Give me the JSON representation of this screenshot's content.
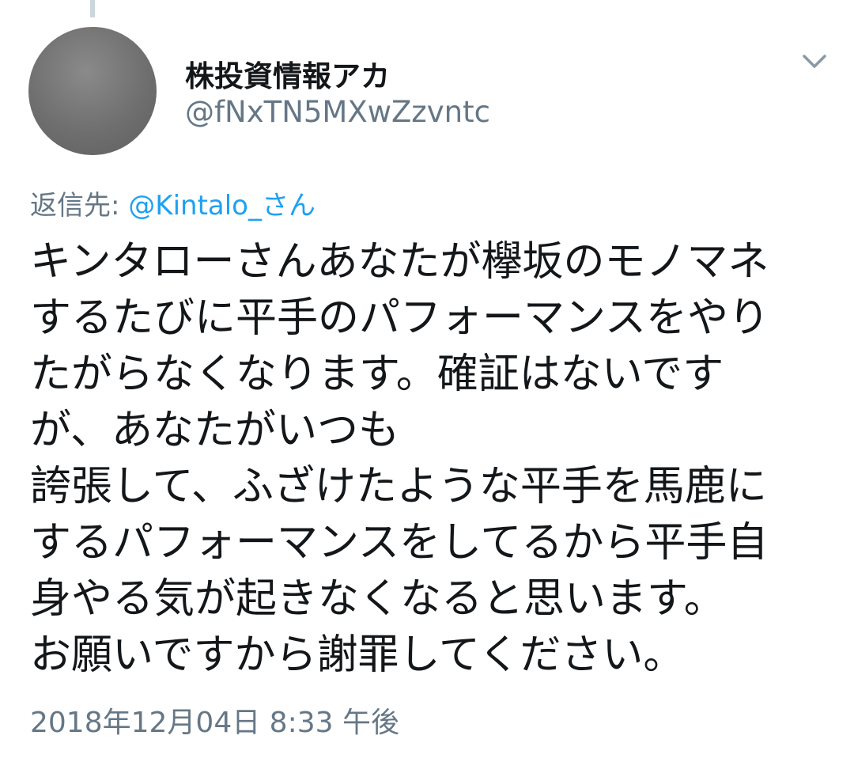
{
  "user": {
    "display_name": "株投資情報アカ",
    "handle": "@fNxTN5MXwZzvntc"
  },
  "reply": {
    "prefix": "返信先:",
    "mention": "@Kintalo_さん"
  },
  "tweet": {
    "text": "キンタローさんあなたが欅坂のモノマネ\nするたびに平手のパフォーマンスをやり\nたがらなくなります。確証はないです\nが、あなたがいつも\n誇張して、ふざけたような平手を馬鹿に\nするパフォーマンスをしてるから平手自\n身やる気が起きなくなると思います。\nお願いですから謝罪してください。"
  },
  "timestamp": "2018年12月04日 8:33 午後",
  "icons": {
    "menu": "chevron-down-icon"
  },
  "colors": {
    "text_primary": "#14171a",
    "text_secondary": "#657786",
    "link": "#1da1f2",
    "thread_line": "#ccd6dd"
  }
}
